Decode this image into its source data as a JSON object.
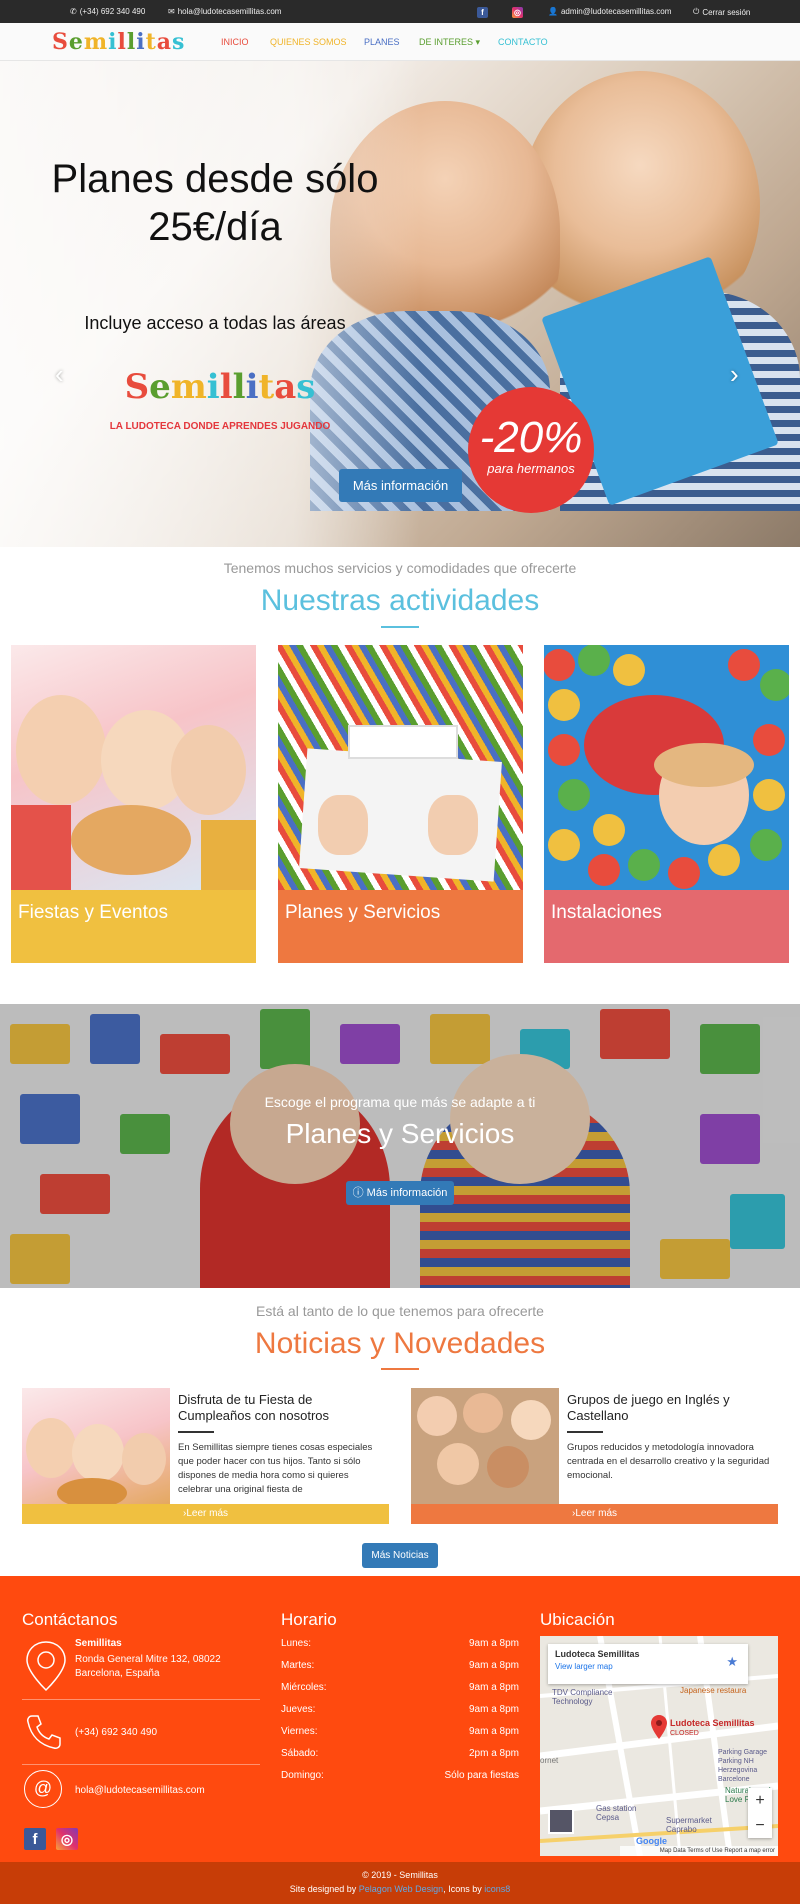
{
  "topbar": {
    "phone": "(+34) 692 340 490",
    "email": "hola@ludotecasemillitas.com",
    "user": "admin@ludotecasemillitas.com",
    "logout": "Cerrar sesión"
  },
  "nav": {
    "logo": "Semillitas",
    "items": [
      {
        "label": "INICIO",
        "color": "#e84c3d"
      },
      {
        "label": "QUIENES SOMOS",
        "color": "#f0b429"
      },
      {
        "label": "PLANES",
        "color": "#4a6fc4"
      },
      {
        "label": "DE INTERES",
        "color": "#5a9e2f"
      },
      {
        "label": "CONTACTO",
        "color": "#36c0d3"
      }
    ]
  },
  "hero": {
    "title_line1": "Planes desde sólo",
    "title_line2": "25€/día",
    "subtitle": "Incluye acceso a todas las áreas",
    "logo": "Semillitas",
    "tagline": "LA LUDOTECA DONDE APRENDES JUGANDO",
    "badge_big": "-20%",
    "badge_small": "para hermanos",
    "button": "Más información",
    "prev_icon": "‹",
    "next_icon": "›"
  },
  "activities": {
    "pre": "Tenemos muchos servicios y comodidades que ofrecerte",
    "title": "Nuestras actividades",
    "title_color": "#5bc0de",
    "cards": [
      {
        "label": "Fiestas y Eventos",
        "color": "#f0c040"
      },
      {
        "label": "Planes y Servicios",
        "color": "#ee7840"
      },
      {
        "label": "Instalaciones",
        "color": "#e4696e"
      }
    ]
  },
  "banner": {
    "pre": "Escoge el programa que más se adapte a ti",
    "title": "Planes y Servicios",
    "button": "Más información"
  },
  "news": {
    "pre": "Está al tanto de lo que tenemos para ofrecerte",
    "title": "Noticias y Novedades",
    "title_color": "#ee7840",
    "items": [
      {
        "title": "Disfruta de tu Fiesta de Cumpleaños con nosotros",
        "text": "En Semillitas siempre tienes cosas especiales que poder hacer con tus hijos. Tanto si sólo dispones de media hora como si quieres celebrar una original fiesta de",
        "more": "Leer más",
        "color": "#f0c040"
      },
      {
        "title": "Grupos de juego en Inglés y Castellano",
        "text": "Grupos reducidos y metodología innovadora centrada en el desarrollo creativo y la seguridad emocional.",
        "more": "Leer más",
        "color": "#ee7840"
      }
    ],
    "more_button": "Más Noticias"
  },
  "footer": {
    "contact_title": "Contáctanos",
    "contact_name": "Semillitas",
    "contact_address": "Ronda General Mitre 132, 08022 Barcelona, España",
    "contact_phone": "(+34) 692 340 490",
    "contact_email": "hola@ludotecasemillitas.com",
    "hours_title": "Horario",
    "hours": [
      {
        "day": "Lunes:",
        "time": "9am a 8pm"
      },
      {
        "day": "Martes:",
        "time": "9am a 8pm"
      },
      {
        "day": "Miércoles:",
        "time": "9am a 8pm"
      },
      {
        "day": "Jueves:",
        "time": "9am a 8pm"
      },
      {
        "day": "Viernes:",
        "time": "9am a 8pm"
      },
      {
        "day": "Sábado:",
        "time": "2pm a 8pm"
      },
      {
        "day": "Domingo:",
        "time": "Sólo para fiestas"
      }
    ],
    "location_title": "Ubicación",
    "map": {
      "place": "Ludoteca Semillitas",
      "larger": "View larger map",
      "pin_label": "Ludoteca Semillitas",
      "pin_status": "CLOSED",
      "poi1": "TDV Compliance Technology",
      "poi2": "Japanese restaura",
      "poi3": "Parking Garage Parking NH Herzegovina Barcelone",
      "poi4": "Natural goo I Love Food",
      "poi5": "Gas station Cepsa",
      "poi6": "Supermarket Caprabo",
      "poi7": "ornet",
      "footer": "Map Data   Terms of Use   Report a map error",
      "google": "Google",
      "zoom_in": "+",
      "zoom_out": "−"
    },
    "copyright": "© 2019 - Semillitas",
    "credits_prefix": "Site designed by ",
    "credits_designer": "Pelagon Web Design",
    "credits_mid": ", Icons by ",
    "credits_icons": "icons8"
  }
}
